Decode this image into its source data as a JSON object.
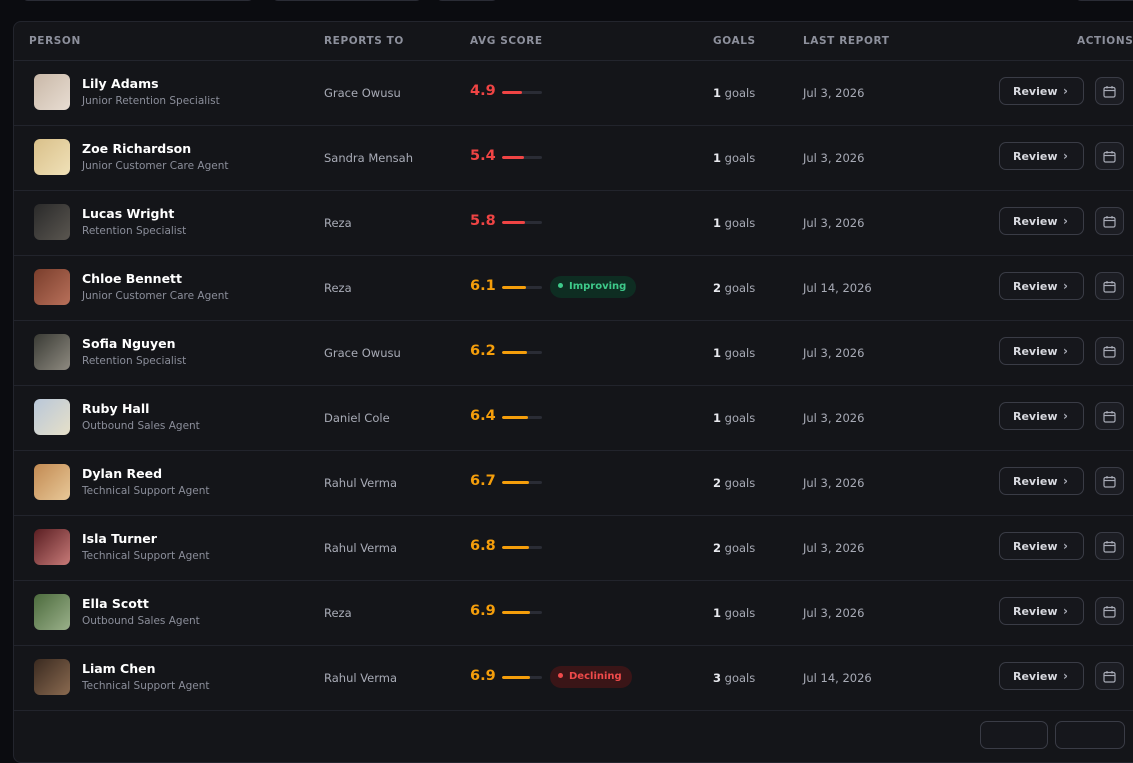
{
  "table": {
    "headers": {
      "person": "PERSON",
      "reports_to": "REPORTS TO",
      "avg_score": "AVG SCORE",
      "goals": "GOALS",
      "last_report": "LAST REPORT",
      "actions": "ACTIONS"
    },
    "rows": [
      {
        "name": "Lily Adams",
        "role": "Junior Retention Specialist",
        "reports_to": "Grace Owusu",
        "score": "4.9",
        "score_value": 4.9,
        "score_color": "#ef4444",
        "goals_count": "1",
        "goals_unit": "goals",
        "last_report": "Jul 3, 2026",
        "trend": null
      },
      {
        "name": "Zoe Richardson",
        "role": "Junior Customer Care Agent",
        "reports_to": "Sandra Mensah",
        "score": "5.4",
        "score_value": 5.4,
        "score_color": "#ef4444",
        "goals_count": "1",
        "goals_unit": "goals",
        "last_report": "Jul 3, 2026",
        "trend": null
      },
      {
        "name": "Lucas Wright",
        "role": "Retention Specialist",
        "reports_to": "Reza",
        "score": "5.8",
        "score_value": 5.8,
        "score_color": "#ef4444",
        "goals_count": "1",
        "goals_unit": "goals",
        "last_report": "Jul 3, 2026",
        "trend": null
      },
      {
        "name": "Chloe Bennett",
        "role": "Junior Customer Care Agent",
        "reports_to": "Reza",
        "score": "6.1",
        "score_value": 6.1,
        "score_color": "#f59e0b",
        "goals_count": "2",
        "goals_unit": "goals",
        "last_report": "Jul 14, 2026",
        "trend": {
          "label": "Improving",
          "kind": "up"
        }
      },
      {
        "name": "Sofia Nguyen",
        "role": "Retention Specialist",
        "reports_to": "Grace Owusu",
        "score": "6.2",
        "score_value": 6.2,
        "score_color": "#f59e0b",
        "goals_count": "1",
        "goals_unit": "goals",
        "last_report": "Jul 3, 2026",
        "trend": null
      },
      {
        "name": "Ruby Hall",
        "role": "Outbound Sales Agent",
        "reports_to": "Daniel Cole",
        "score": "6.4",
        "score_value": 6.4,
        "score_color": "#f59e0b",
        "goals_count": "1",
        "goals_unit": "goals",
        "last_report": "Jul 3, 2026",
        "trend": null
      },
      {
        "name": "Dylan Reed",
        "role": "Technical Support Agent",
        "reports_to": "Rahul Verma",
        "score": "6.7",
        "score_value": 6.7,
        "score_color": "#f59e0b",
        "goals_count": "2",
        "goals_unit": "goals",
        "last_report": "Jul 3, 2026",
        "trend": null
      },
      {
        "name": "Isla Turner",
        "role": "Technical Support Agent",
        "reports_to": "Rahul Verma",
        "score": "6.8",
        "score_value": 6.8,
        "score_color": "#f59e0b",
        "goals_count": "2",
        "goals_unit": "goals",
        "last_report": "Jul 3, 2026",
        "trend": null
      },
      {
        "name": "Ella Scott",
        "role": "Outbound Sales Agent",
        "reports_to": "Reza",
        "score": "6.9",
        "score_value": 6.9,
        "score_color": "#f59e0b",
        "goals_count": "1",
        "goals_unit": "goals",
        "last_report": "Jul 3, 2026",
        "trend": null
      },
      {
        "name": "Liam Chen",
        "role": "Technical Support Agent",
        "reports_to": "Rahul Verma",
        "score": "6.9",
        "score_value": 6.9,
        "score_color": "#f59e0b",
        "goals_count": "3",
        "goals_unit": "goals",
        "last_report": "Jul 14, 2026",
        "trend": {
          "label": "Declining",
          "kind": "down"
        }
      }
    ],
    "review_label": "Review",
    "icons": {
      "review": "chevron-right-icon",
      "calendar": "calendar-icon"
    }
  },
  "colors": {
    "score_low": "#ef4444",
    "score_mid": "#f59e0b",
    "trend_up": "#3ec98a",
    "trend_down": "#ef4a4a"
  }
}
